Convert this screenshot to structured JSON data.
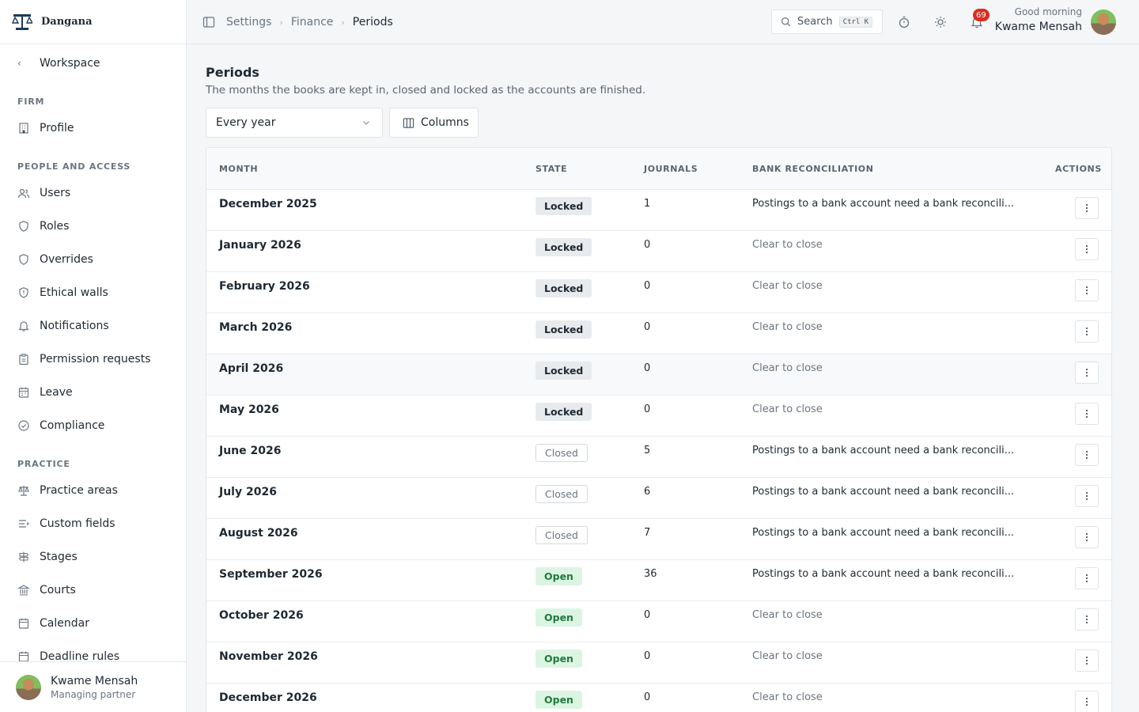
{
  "brand": {
    "name": "Dangana"
  },
  "sidebar": {
    "back_label": "Workspace",
    "sections": {
      "firm": "FIRM",
      "people": "PEOPLE AND ACCESS",
      "practice": "PRACTICE"
    },
    "items": [
      {
        "label": "Profile",
        "icon": "building-icon"
      },
      {
        "label": "Users",
        "icon": "users-icon"
      },
      {
        "label": "Roles",
        "icon": "shield-icon"
      },
      {
        "label": "Overrides",
        "icon": "shield-icon"
      },
      {
        "label": "Ethical walls",
        "icon": "shield-alert-icon"
      },
      {
        "label": "Notifications",
        "icon": "bell-icon"
      },
      {
        "label": "Permission requests",
        "icon": "clipboard-icon"
      },
      {
        "label": "Leave",
        "icon": "calendar-icon"
      },
      {
        "label": "Compliance",
        "icon": "check-circle-icon"
      },
      {
        "label": "Practice areas",
        "icon": "scale-icon"
      },
      {
        "label": "Custom fields",
        "icon": "list-icon"
      },
      {
        "label": "Stages",
        "icon": "signpost-icon"
      },
      {
        "label": "Courts",
        "icon": "courthouse-icon"
      },
      {
        "label": "Calendar",
        "icon": "calendar-icon"
      },
      {
        "label": "Deadline rules",
        "icon": "calendar-clock-icon"
      }
    ],
    "footer": {
      "name": "Kwame Mensah",
      "role": "Managing partner"
    }
  },
  "topbar": {
    "breadcrumbs": [
      "Settings",
      "Finance",
      "Periods"
    ],
    "search_label": "Search",
    "search_shortcut": "Ctrl K",
    "notification_count": "69",
    "greeting": "Good morning",
    "user_name": "Kwame Mensah"
  },
  "page": {
    "title": "Periods",
    "subtitle": "The months the books are kept in, closed and locked as the accounts are finished.",
    "filter_value": "Every year",
    "columns_button": "Columns"
  },
  "table": {
    "headers": {
      "month": "MONTH",
      "state": "STATE",
      "journals": "JOURNALS",
      "recon": "BANK RECONCILIATION",
      "actions": "ACTIONS"
    },
    "rows": [
      {
        "month": "December 2025",
        "state": "Locked",
        "journals": "1",
        "recon": "Postings to a bank account need a bank reconcili..."
      },
      {
        "month": "January 2026",
        "state": "Locked",
        "journals": "0",
        "recon": "Clear to close"
      },
      {
        "month": "February 2026",
        "state": "Locked",
        "journals": "0",
        "recon": "Clear to close"
      },
      {
        "month": "March 2026",
        "state": "Locked",
        "journals": "0",
        "recon": "Clear to close"
      },
      {
        "month": "April 2026",
        "state": "Locked",
        "journals": "0",
        "recon": "Clear to close"
      },
      {
        "month": "May 2026",
        "state": "Locked",
        "journals": "0",
        "recon": "Clear to close"
      },
      {
        "month": "June 2026",
        "state": "Closed",
        "journals": "5",
        "recon": "Postings to a bank account need a bank reconcili..."
      },
      {
        "month": "July 2026",
        "state": "Closed",
        "journals": "6",
        "recon": "Postings to a bank account need a bank reconcili..."
      },
      {
        "month": "August 2026",
        "state": "Closed",
        "journals": "7",
        "recon": "Postings to a bank account need a bank reconcili..."
      },
      {
        "month": "September 2026",
        "state": "Open",
        "journals": "36",
        "recon": "Postings to a bank account need a bank reconcili..."
      },
      {
        "month": "October 2026",
        "state": "Open",
        "journals": "0",
        "recon": "Clear to close"
      },
      {
        "month": "November 2026",
        "state": "Open",
        "journals": "0",
        "recon": "Clear to close"
      },
      {
        "month": "December 2026",
        "state": "Open",
        "journals": "0",
        "recon": "Clear to close"
      }
    ]
  },
  "colors": {
    "open": "#dcf5e3",
    "locked": "#e8ebee",
    "badge": "#d92d20"
  }
}
